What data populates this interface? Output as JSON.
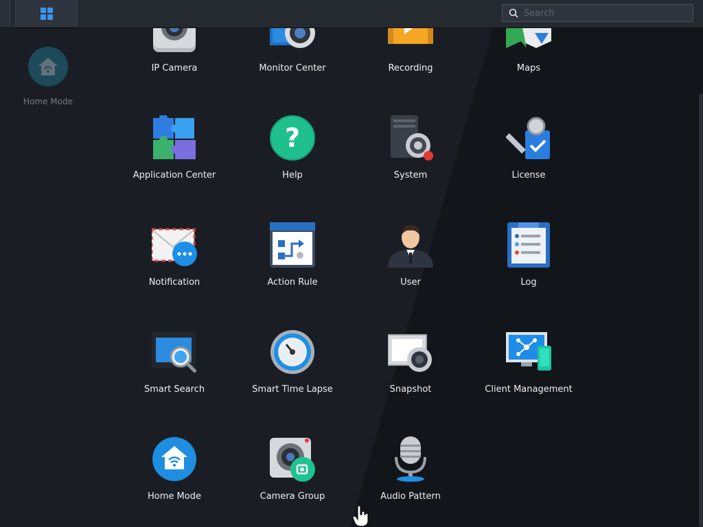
{
  "topbar": {
    "search_placeholder": "Search"
  },
  "desktop": {
    "home_mode_label": "Home Mode"
  },
  "apps": [
    {
      "label": "IP Camera",
      "icon": "ip-camera-icon"
    },
    {
      "label": "Monitor Center",
      "icon": "monitor-center-icon"
    },
    {
      "label": "Recording",
      "icon": "recording-icon"
    },
    {
      "label": "Maps",
      "icon": "maps-icon"
    },
    {
      "label": "Application Center",
      "icon": "puzzle-icon"
    },
    {
      "label": "Help",
      "icon": "help-icon"
    },
    {
      "label": "System",
      "icon": "system-gear-icon"
    },
    {
      "label": "License",
      "icon": "license-key-icon"
    },
    {
      "label": "Notification",
      "icon": "notification-envelope-icon"
    },
    {
      "label": "Action Rule",
      "icon": "action-rule-icon"
    },
    {
      "label": "User",
      "icon": "user-icon"
    },
    {
      "label": "Log",
      "icon": "log-icon"
    },
    {
      "label": "Smart Search",
      "icon": "smart-search-icon"
    },
    {
      "label": "Smart Time Lapse",
      "icon": "timer-icon"
    },
    {
      "label": "Snapshot",
      "icon": "snapshot-icon"
    },
    {
      "label": "Client Management",
      "icon": "client-management-icon"
    },
    {
      "label": "Home Mode",
      "icon": "home-wifi-icon"
    },
    {
      "label": "Camera Group",
      "icon": "camera-group-icon"
    },
    {
      "label": "Audio Pattern",
      "icon": "microphone-icon"
    }
  ],
  "colors": {
    "accent": "#2b8fe0",
    "system_badge": "#e53935"
  }
}
